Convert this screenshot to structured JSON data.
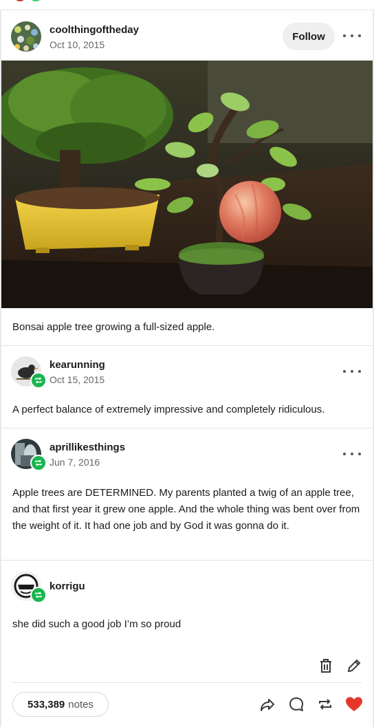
{
  "post": {
    "author": "coolthingoftheday",
    "date": "Oct 10, 2015",
    "follow_label": "Follow",
    "caption": "Bonsai apple tree growing a full-sized apple.",
    "image_alt": "Bonsai apple tree with a large red apple next to a yellow-potted bonsai"
  },
  "reblogs": [
    {
      "author": "kearunning",
      "date": "Oct 15, 2015",
      "text": "A perfect balance of extremely impressive and completely ridiculous."
    },
    {
      "author": "aprillikesthings",
      "date": "Jun 7, 2016",
      "text": "Apple trees are DETERMINED. My parents planted a twig of an apple tree, and that first year it grew one apple. And the whole thing was bent over from the weight of it. It had one job and by God it was gonna do it."
    },
    {
      "author": "korrigu",
      "text": "she did such a good job I’m so proud"
    }
  ],
  "footer": {
    "notes_count": "533,389",
    "notes_label": "notes"
  },
  "colors": {
    "reblog_green": "#19b54e",
    "like_red": "#e5382a",
    "follow_bg": "#efefef"
  },
  "icons": [
    "more-icon",
    "reblog-icon",
    "trash-icon",
    "edit-icon",
    "share-icon",
    "reply-icon",
    "like-icon"
  ]
}
